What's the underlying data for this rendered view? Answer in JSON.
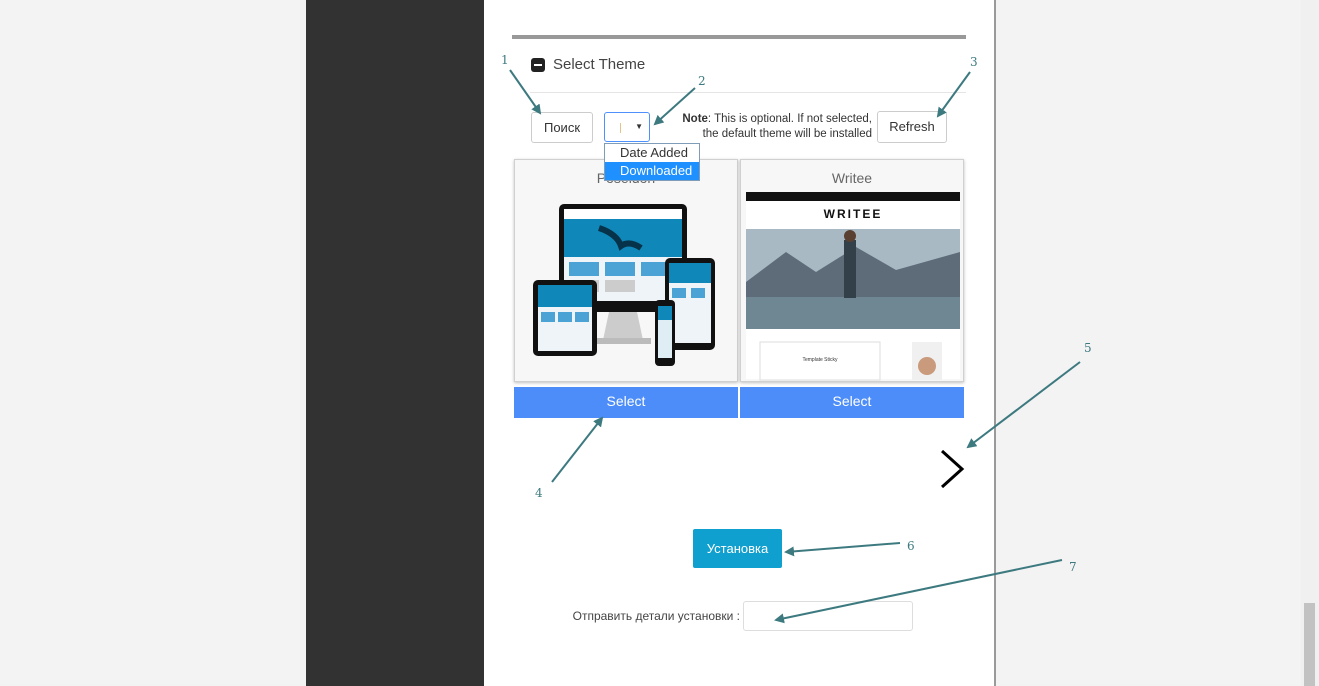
{
  "section": {
    "title": "Select Theme"
  },
  "toolbar": {
    "search_label": "Поиск",
    "refresh_label": "Refresh",
    "note_bold": "Note",
    "note_line1": ": This is optional. If not selected,",
    "note_line2": "the default theme will be installed"
  },
  "sort_dropdown": {
    "options": [
      "Date Added",
      "Downloaded"
    ],
    "highlighted": "Downloaded"
  },
  "themes": [
    {
      "title": "Poseidon",
      "select_label": "Select"
    },
    {
      "title": "Writee",
      "select_label": "Select",
      "preview_logo": "WRITEE",
      "preview_post": "Template Sticky"
    }
  ],
  "install": {
    "button_label": "Установка"
  },
  "send_details": {
    "label": "Отправить детали установки :"
  },
  "annotations": [
    "1",
    "2",
    "3",
    "4",
    "5",
    "6",
    "7"
  ],
  "colors": {
    "select_blue": "#4d8dfa",
    "install_cyan": "#10a0cf",
    "annotation_teal": "#3d7a80",
    "sidebar_dark": "#323232"
  },
  "icons": {
    "collapse": "minus-square-icon",
    "next": "chevron-right-icon",
    "caret": "caret-down-icon"
  }
}
